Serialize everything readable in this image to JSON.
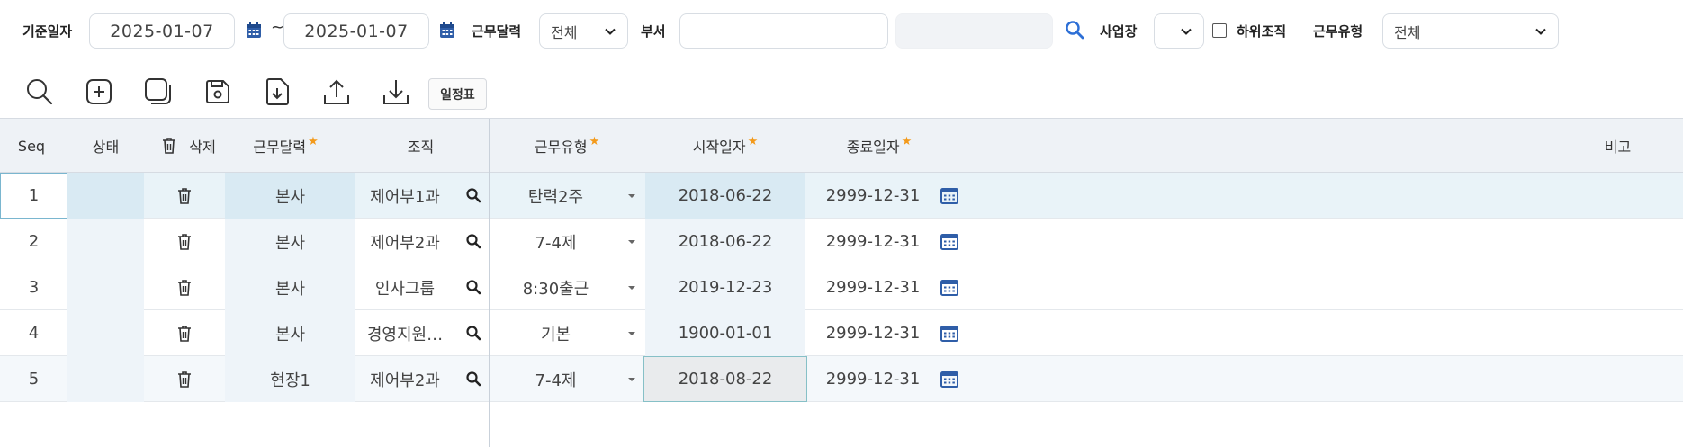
{
  "search": {
    "base_date_label": "기준일자",
    "start_date": "2025-01-07",
    "tilde": "~",
    "end_date": "2025-01-07",
    "calendar_label": "근무달력",
    "calendar_value": "전체",
    "dept_label": "부서",
    "dept_value": "",
    "site_label": "사업장",
    "site_value": "",
    "sub_org_label": "하위조직",
    "work_type_label": "근무유형",
    "work_type_value": "전체"
  },
  "toolbar": {
    "schedule_button": "일정표",
    "icons": [
      "search-icon",
      "add-icon",
      "copy-icon",
      "save-icon",
      "download-file-icon",
      "upload-icon",
      "download-icon"
    ]
  },
  "grid": {
    "columns": {
      "seq": "Seq",
      "status": "상태",
      "delete": "삭제",
      "calendar": "근무달력",
      "org": "조직",
      "work_type": "근무유형",
      "start_date": "시작일자",
      "end_date": "종료일자",
      "note": "비고"
    },
    "required_mark": "★",
    "rows": [
      {
        "seq": "1",
        "status": "",
        "calendar": "본사",
        "org": "제어부1과",
        "work_type": "탄력2주",
        "start_date": "2018-06-22",
        "end_date": "2999-12-31",
        "note": ""
      },
      {
        "seq": "2",
        "status": "",
        "calendar": "본사",
        "org": "제어부2과",
        "work_type": "7-4제",
        "start_date": "2018-06-22",
        "end_date": "2999-12-31",
        "note": ""
      },
      {
        "seq": "3",
        "status": "",
        "calendar": "본사",
        "org": "인사그룹",
        "work_type": "8:30출근",
        "start_date": "2019-12-23",
        "end_date": "2999-12-31",
        "note": ""
      },
      {
        "seq": "4",
        "status": "",
        "calendar": "본사",
        "org": "경영지원…",
        "work_type": "기본",
        "start_date": "1900-01-01",
        "end_date": "2999-12-31",
        "note": ""
      },
      {
        "seq": "5",
        "status": "",
        "calendar": "현장1",
        "org": "제어부2과",
        "work_type": "7-4제",
        "start_date": "2018-08-22",
        "end_date": "2999-12-31",
        "note": ""
      }
    ]
  },
  "colors": {
    "accent": "#2d6fd6",
    "required_star": "#f39a1b",
    "header_bg": "#eef2f6",
    "selected_row": "#e9f3f8"
  }
}
